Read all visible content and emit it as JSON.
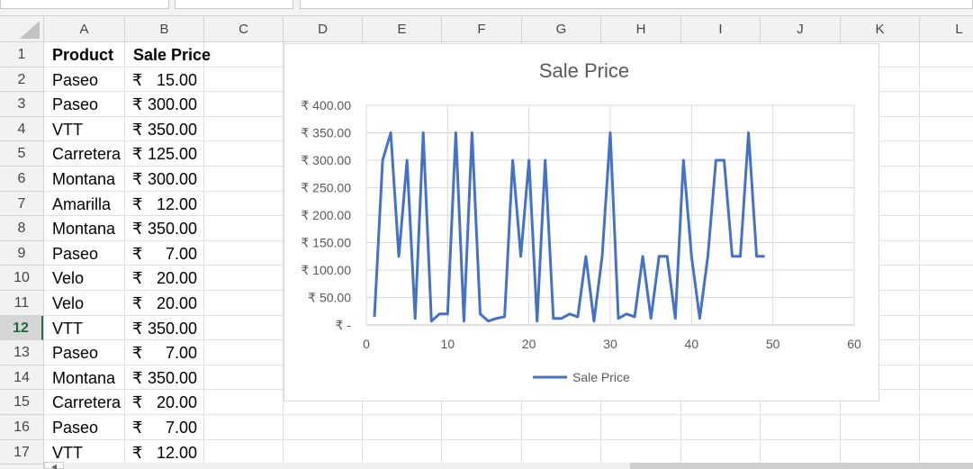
{
  "columns": [
    "A",
    "B",
    "C",
    "D",
    "E",
    "F",
    "G",
    "H",
    "I",
    "J",
    "K",
    "L"
  ],
  "rows": [
    "1",
    "2",
    "3",
    "4",
    "5",
    "6",
    "7",
    "8",
    "9",
    "10",
    "11",
    "12",
    "13",
    "14",
    "15",
    "16",
    "17"
  ],
  "active_row": "12",
  "table": {
    "headers": [
      "Product",
      "Sale Price"
    ],
    "currency_symbol": "₹",
    "data": [
      {
        "product": "Paseo",
        "price": "15.00"
      },
      {
        "product": "Paseo",
        "price": "300.00"
      },
      {
        "product": "VTT",
        "price": "350.00"
      },
      {
        "product": "Carretera",
        "price": "125.00"
      },
      {
        "product": "Montana",
        "price": "300.00"
      },
      {
        "product": "Amarilla",
        "price": "12.00"
      },
      {
        "product": "Montana",
        "price": "350.00"
      },
      {
        "product": "Paseo",
        "price": "7.00"
      },
      {
        "product": "Velo",
        "price": "20.00"
      },
      {
        "product": "Velo",
        "price": "20.00"
      },
      {
        "product": "VTT",
        "price": "350.00"
      },
      {
        "product": "Paseo",
        "price": "7.00"
      },
      {
        "product": "Montana",
        "price": "350.00"
      },
      {
        "product": "Carretera",
        "price": "20.00"
      },
      {
        "product": "Paseo",
        "price": "7.00"
      },
      {
        "product": "VTT",
        "price": "12.00"
      }
    ]
  },
  "chart_data": {
    "type": "line",
    "title": "Sale Price",
    "xlabel": "",
    "ylabel": "",
    "xlim": [
      0,
      60
    ],
    "ylim": [
      0,
      400
    ],
    "x_ticks": [
      "0",
      "10",
      "20",
      "30",
      "40",
      "50",
      "60"
    ],
    "y_ticks": [
      "₹ -",
      "₹ 50.00",
      "₹ 100.00",
      "₹ 150.00",
      "₹ 200.00",
      "₹ 250.00",
      "₹ 300.00",
      "₹ 350.00",
      "₹ 400.00"
    ],
    "grid": true,
    "legend": "bottom",
    "color": "#4472c4",
    "series": [
      {
        "name": "Sale Price",
        "x": [
          1,
          2,
          3,
          4,
          5,
          6,
          7,
          8,
          9,
          10,
          11,
          12,
          13,
          14,
          15,
          16,
          17,
          18,
          19,
          20,
          21,
          22,
          23,
          24,
          25,
          26,
          27,
          28,
          29,
          30,
          31,
          32,
          33,
          34,
          35,
          36,
          37,
          38,
          39,
          40,
          41,
          42,
          43,
          44,
          45,
          46,
          47,
          48,
          49
        ],
        "values": [
          15,
          300,
          350,
          125,
          300,
          12,
          350,
          7,
          20,
          20,
          350,
          7,
          350,
          20,
          7,
          12,
          15,
          300,
          125,
          300,
          7,
          300,
          12,
          12,
          20,
          15,
          125,
          7,
          125,
          350,
          12,
          20,
          15,
          125,
          12,
          125,
          125,
          12,
          300,
          125,
          12,
          125,
          300,
          300,
          125,
          125,
          350,
          125,
          125
        ]
      }
    ]
  }
}
